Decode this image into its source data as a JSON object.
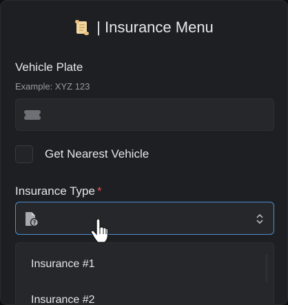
{
  "dialog": {
    "title": "| Insurance Menu",
    "title_icon": "scroll-icon"
  },
  "plate": {
    "label": "Vehicle Plate",
    "hint": "Example: XYZ 123",
    "value": "",
    "icon": "license-plate-icon"
  },
  "nearest": {
    "label": "Get Nearest Vehicle",
    "checked": false
  },
  "insurance_type": {
    "label": "Insurance Type",
    "required_mark": "*",
    "value": "",
    "icon": "document-question-icon",
    "options": [
      {
        "label": "Insurance #1"
      },
      {
        "label": "Insurance #2"
      }
    ]
  },
  "colors": {
    "panel": "#1e1f23",
    "input": "#26272b",
    "focus_border": "#4f8fd0",
    "required": "#e35252"
  }
}
